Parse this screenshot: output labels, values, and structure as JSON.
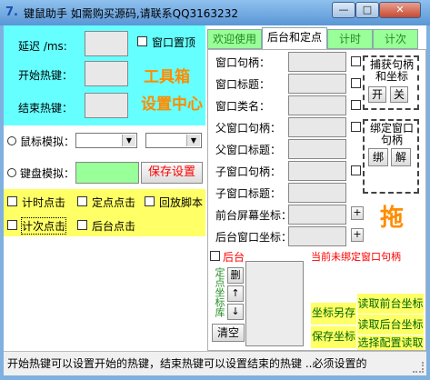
{
  "window": {
    "icon_glyph": "7.",
    "title": "键鼠助手   如需购买源码,请联系QQ3163232",
    "min_glyph": "—",
    "max_glyph": "□",
    "close_glyph": "✕"
  },
  "left": {
    "delay_label": "延迟 /ms:",
    "top_label": "窗口置顶",
    "start_hotkey_label": "开始热键：",
    "end_hotkey_label": "结束热键：",
    "toolbox_label": "工具箱",
    "settings_center_label": "设置中心",
    "mouse_sim_label": "鼠标模拟：",
    "keyboard_sim_label": "键盘模拟：",
    "save_settings_label": "保存设置",
    "timer_click_label": "计时点击",
    "fixed_click_label": "定点点击",
    "replay_script_label": "回放脚本",
    "count_click_label": "计次点击",
    "background_click_label": "后台点击"
  },
  "tabs": [
    "欢迎使用",
    "后台和定点",
    "计时",
    "计次"
  ],
  "active_tab": "后台和定点",
  "bg_tab": {
    "fields": [
      "窗口句柄：",
      "窗口标题：",
      "窗口类名：",
      "父窗口句柄：",
      "父窗口标题：",
      "子窗口句柄：",
      "子窗口标题：",
      "前台屏幕坐标：",
      "后台窗口坐标："
    ],
    "capture_box_title": "捕获句柄和坐标",
    "capture_on": "开",
    "capture_off": "关",
    "bind_box_title": "绑定窗口句柄",
    "bind_label": "绑",
    "unbind_label": "解",
    "drag_label": "拖",
    "plus_glyph": "+",
    "backend_label": "后台",
    "unbound_status": "当前未绑定窗口句柄",
    "fixed_coord_lib_label": "定点坐标库",
    "delete_label": "删",
    "up_label": "↑",
    "down_label": "↓",
    "clear_label": "清空",
    "coord_save_as_label": "坐标另存",
    "save_coord_label": "保存坐标",
    "read_fg_coord_label": "读取前台坐标",
    "read_bg_coord_label": "读取后台坐标",
    "select_config_read_label": "选择配置读取"
  },
  "status": {
    "text": "开始热键可以设置开始的热键，结束热键可以设置结束的热键 ..必须设置的"
  },
  "colors": {
    "cyan_panel": "#66ffff",
    "yellow_panel": "#ffff66",
    "tab_green": "#99ff99",
    "accent_orange": "#ff8c00",
    "alert_red": "#ff0000"
  }
}
